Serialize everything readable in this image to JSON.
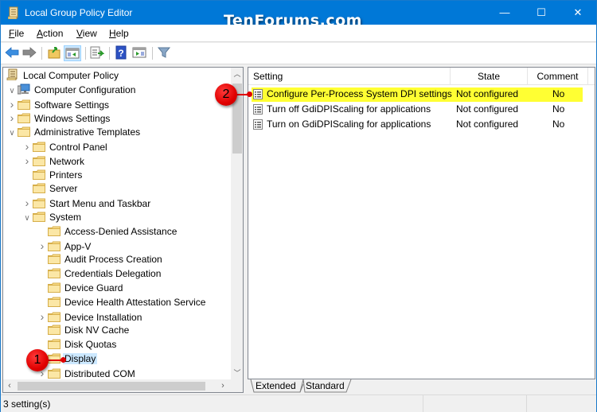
{
  "window": {
    "title": "Local Group Policy Editor",
    "watermark": "TenForums.com",
    "controls": {
      "minimize": "—",
      "maximize": "☐",
      "close": "✕"
    }
  },
  "menubar": {
    "items": [
      {
        "label": "File",
        "accel": "F",
        "rest": "ile"
      },
      {
        "label": "Action",
        "accel": "A",
        "rest": "ction"
      },
      {
        "label": "View",
        "accel": "V",
        "rest": "iew"
      },
      {
        "label": "Help",
        "accel": "H",
        "rest": "elp"
      }
    ]
  },
  "toolbar": {
    "buttons": [
      "back",
      "forward",
      "up-one-level",
      "show-hide-console-tree",
      "export-list",
      "help",
      "show-hide-action-pane",
      "filter"
    ]
  },
  "tree": {
    "items": [
      {
        "label": "Local Computer Policy",
        "level": 0,
        "expander": "",
        "icon": "policy"
      },
      {
        "label": "Computer Configuration",
        "level": 0,
        "expander": "expanded",
        "icon": "computer"
      },
      {
        "label": "Software Settings",
        "level": 1,
        "expander": "collapsed",
        "icon": "folder"
      },
      {
        "label": "Windows Settings",
        "level": 1,
        "expander": "collapsed",
        "icon": "folder"
      },
      {
        "label": "Administrative Templates",
        "level": 1,
        "expander": "expanded",
        "icon": "folder"
      },
      {
        "label": "Control Panel",
        "level": 2,
        "expander": "collapsed",
        "icon": "folder"
      },
      {
        "label": "Network",
        "level": 2,
        "expander": "collapsed",
        "icon": "folder"
      },
      {
        "label": "Printers",
        "level": 2,
        "expander": "",
        "icon": "folder"
      },
      {
        "label": "Server",
        "level": 2,
        "expander": "",
        "icon": "folder"
      },
      {
        "label": "Start Menu and Taskbar",
        "level": 2,
        "expander": "collapsed",
        "icon": "folder"
      },
      {
        "label": "System",
        "level": 2,
        "expander": "expanded",
        "icon": "folder"
      },
      {
        "label": "Access-Denied Assistance",
        "level": 3,
        "expander": "",
        "icon": "folder"
      },
      {
        "label": "App-V",
        "level": 3,
        "expander": "collapsed",
        "icon": "folder"
      },
      {
        "label": "Audit Process Creation",
        "level": 3,
        "expander": "",
        "icon": "folder"
      },
      {
        "label": "Credentials Delegation",
        "level": 3,
        "expander": "",
        "icon": "folder"
      },
      {
        "label": "Device Guard",
        "level": 3,
        "expander": "",
        "icon": "folder"
      },
      {
        "label": "Device Health Attestation Service",
        "level": 3,
        "expander": "",
        "icon": "folder"
      },
      {
        "label": "Device Installation",
        "level": 3,
        "expander": "collapsed",
        "icon": "folder"
      },
      {
        "label": "Disk NV Cache",
        "level": 3,
        "expander": "",
        "icon": "folder"
      },
      {
        "label": "Disk Quotas",
        "level": 3,
        "expander": "",
        "icon": "folder"
      },
      {
        "label": "Display",
        "level": 3,
        "expander": "",
        "icon": "folder",
        "selected": true
      },
      {
        "label": "Distributed COM",
        "level": 3,
        "expander": "collapsed",
        "icon": "folder"
      }
    ]
  },
  "list": {
    "columns": [
      "Setting",
      "State",
      "Comment"
    ],
    "rows": [
      {
        "setting": "Configure Per-Process System DPI settings",
        "state": "Not configured",
        "comment": "No",
        "highlighted": true
      },
      {
        "setting": "Turn off GdiDPIScaling for applications",
        "state": "Not configured",
        "comment": "No"
      },
      {
        "setting": "Turn on GdiDPIScaling for applications",
        "state": "Not configured",
        "comment": "No"
      }
    ]
  },
  "tabs": [
    {
      "label": "Extended",
      "active": false
    },
    {
      "label": "Standard",
      "active": true
    }
  ],
  "status": {
    "text": "3 setting(s)"
  },
  "callouts": [
    {
      "number": "1",
      "target": "Display"
    },
    {
      "number": "2",
      "target": "Configure Per-Process System DPI settings"
    }
  ],
  "colors": {
    "titlebar": "#0078d7",
    "highlight": "#ffff33",
    "selection": "#cce8ff",
    "callout": "#e00000"
  }
}
